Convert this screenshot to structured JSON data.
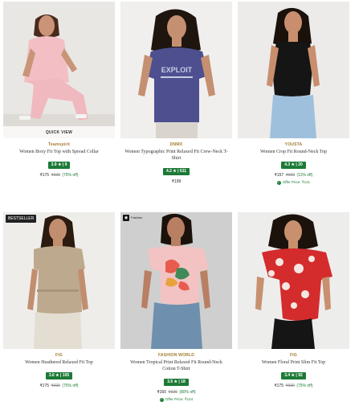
{
  "products": [
    {
      "brand": "Teamspirit",
      "name": "Women Boxy Fit Top with Spread Collar",
      "rating": "3.9 ★ | 9",
      "price": "₹175",
      "mrp": "₹699",
      "discount": "(75% off)",
      "overlay": "QUICK VIEW",
      "image": "woman-pink-polo-tracksuit",
      "colors": {
        "bg": "#e9e7e4",
        "top": "#f3bfc5",
        "bottom": "#f0b8bf",
        "skin": "#c99478",
        "hair": "#4a2a1a"
      }
    },
    {
      "brand": "DNMX",
      "name": "Women Typographic Print Relaxed Fit Crew-Neck T-Shirt",
      "rating": "4.2 ★ | 611",
      "price": "₹199",
      "print_text": "EXPLOIT",
      "image": "woman-navy-printed-tshirt",
      "colors": {
        "bg": "#f0efee",
        "top": "#4d4f8f",
        "bottom": "#d9d4cc",
        "skin": "#c59071",
        "hair": "#1f150f"
      }
    },
    {
      "brand": "YOUSTA",
      "name": "Women Crop Fit Round-Neck Top",
      "rating": "4.3 ★ | 20",
      "price": "₹157",
      "mrp": "₹699",
      "discount": "(11% off)",
      "offer": "Offer Price: ₹141",
      "image": "woman-black-tank-denim",
      "colors": {
        "bg": "#ecebea",
        "top": "#151515",
        "bottom": "#9fc0dc",
        "skin": "#c98e6e",
        "hair": "#1a110b"
      }
    },
    {
      "tag": "BESTSELLER",
      "brand": "FIG",
      "name": "Women Heathered Relaxed Fit Top",
      "rating": "3.6 ★ | 105",
      "price": "₹175",
      "mrp": "₹699",
      "discount": "(75% off)",
      "image": "woman-beige-belted-top",
      "colors": {
        "bg": "#efedea",
        "top": "#bda98d",
        "bottom": "#e3ddd2",
        "skin": "#c28e70",
        "hair": "#2b1a10"
      }
    },
    {
      "brand": "FASHION WORLD",
      "brand_logo": "Fashion",
      "name": "Women Tropical Print Relaxed Fit Round-Neck Cotton T-Shirt",
      "rating": "3.5 ★ | 18",
      "price": "₹160",
      "mrp": "₹699",
      "discount": "(80% off)",
      "offer": "Offer Price: ₹144",
      "image": "woman-pink-tropical-tshirt-jeans",
      "colors": {
        "bg": "#cfcfcf",
        "top": "#f2c3c2",
        "bottom": "#6f8fae",
        "skin": "#b97f62",
        "hair": "#1a110b"
      }
    },
    {
      "brand": "FIG",
      "name": "Women Floral Print Slim Fit Top",
      "rating": "3.4 ★ | 92",
      "price": "₹175",
      "mrp": "₹699",
      "discount": "(75% off)",
      "image": "woman-red-floral-top",
      "colors": {
        "bg": "#ededec",
        "top": "#d42c2c",
        "bottom": "#151515",
        "skin": "#c8906f",
        "hair": "#1c120c"
      }
    }
  ],
  "accent": {
    "rating_bg": "#1d7a36",
    "brand_color": "#a47b2f"
  }
}
